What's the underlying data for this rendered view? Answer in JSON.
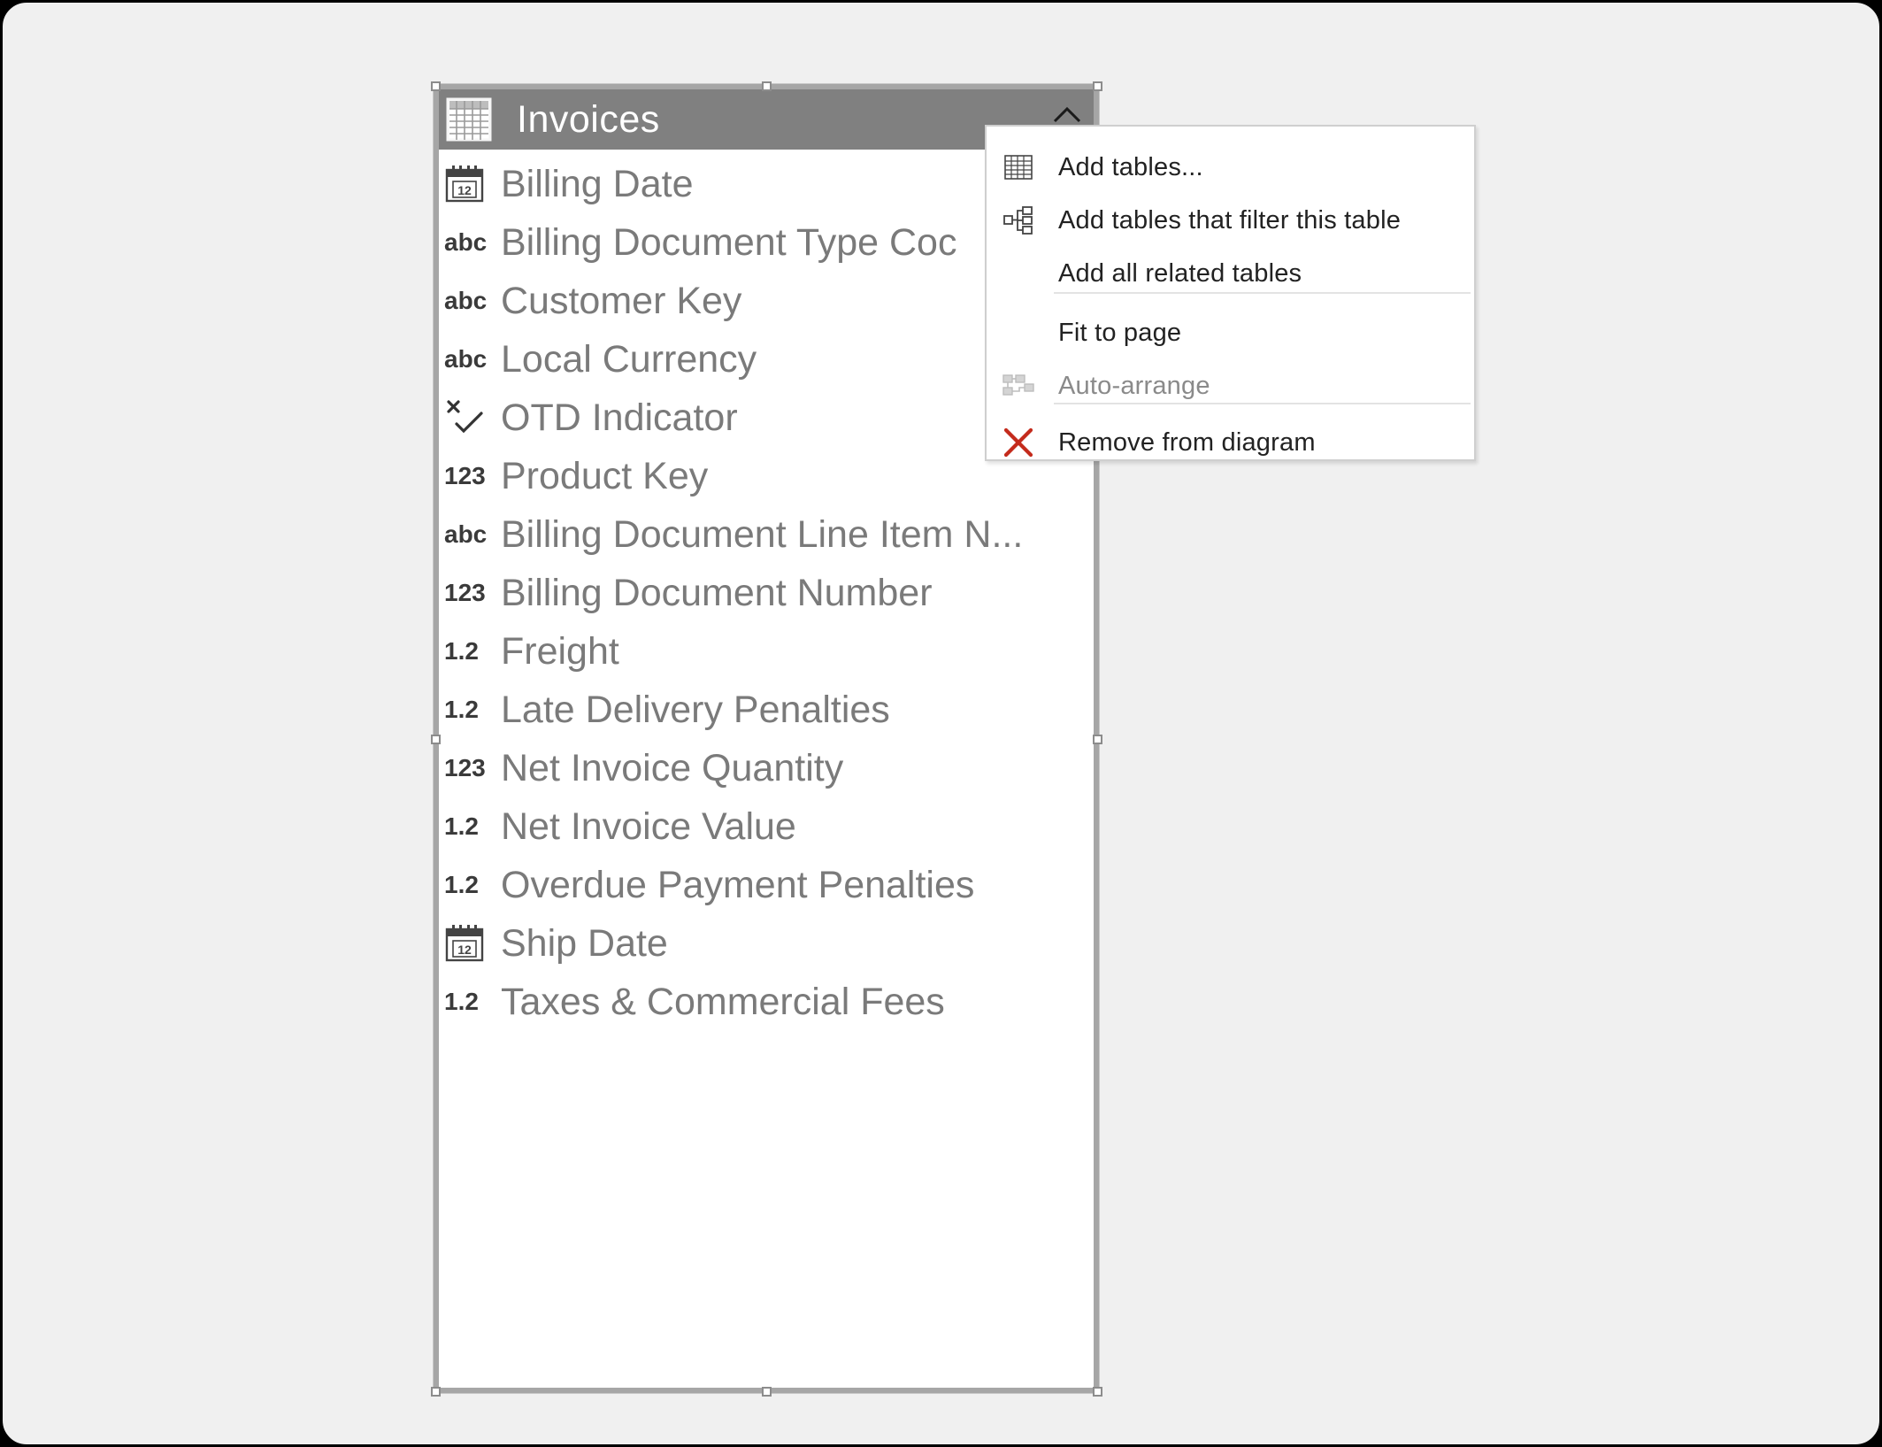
{
  "table": {
    "title": "Invoices",
    "icon": "table-icon",
    "fields": [
      {
        "type": "date",
        "type_label": "",
        "name": "Billing Date"
      },
      {
        "type": "text",
        "type_label": "abc",
        "name": "Billing Document Type Coc"
      },
      {
        "type": "text",
        "type_label": "abc",
        "name": "Customer Key"
      },
      {
        "type": "text",
        "type_label": "abc",
        "name": "Local Currency"
      },
      {
        "type": "boolean",
        "type_label": "",
        "name": "OTD Indicator"
      },
      {
        "type": "integer",
        "type_label": "123",
        "name": "Product Key"
      },
      {
        "type": "text",
        "type_label": "abc",
        "name": "Billing Document Line Item N..."
      },
      {
        "type": "integer",
        "type_label": "123",
        "name": "Billing Document Number"
      },
      {
        "type": "decimal",
        "type_label": "1.2",
        "name": "Freight"
      },
      {
        "type": "decimal",
        "type_label": "1.2",
        "name": "Late Delivery Penalties"
      },
      {
        "type": "integer",
        "type_label": "123",
        "name": "Net Invoice Quantity"
      },
      {
        "type": "decimal",
        "type_label": "1.2",
        "name": "Net Invoice Value"
      },
      {
        "type": "decimal",
        "type_label": "1.2",
        "name": "Overdue Payment Penalties"
      },
      {
        "type": "date",
        "type_label": "",
        "name": "Ship Date"
      },
      {
        "type": "decimal",
        "type_label": "1.2",
        "name": "Taxes & Commercial Fees"
      }
    ]
  },
  "context_menu": {
    "items": [
      {
        "label": "Add tables...",
        "icon": "table-grid-icon",
        "enabled": true
      },
      {
        "label": "Add tables that filter this table",
        "icon": "hierarchy-icon",
        "enabled": true
      },
      {
        "label": "Add all related tables",
        "icon": "",
        "enabled": true
      },
      {
        "label": "Fit to page",
        "icon": "",
        "enabled": true
      },
      {
        "label": "Auto-arrange",
        "icon": "auto-arrange-icon",
        "enabled": false
      },
      {
        "label": "Remove from diagram",
        "icon": "red-x-icon",
        "enabled": true
      }
    ]
  },
  "colors": {
    "header_bg": "#808080",
    "field_text": "#7a7a7a",
    "remove_icon": "#c42b1c"
  }
}
